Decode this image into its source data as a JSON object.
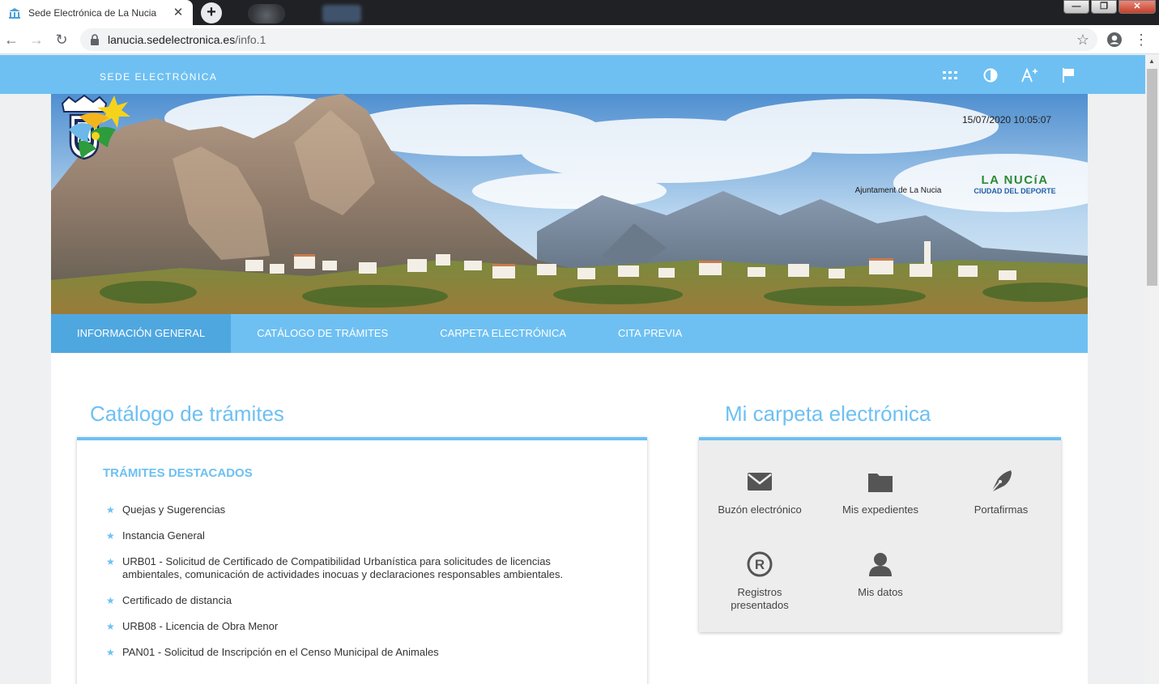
{
  "browser": {
    "tab_title": "Sede Electrónica de La Nucia",
    "url_host": "lanucia.sedelectronica.es",
    "url_path": "/info.1",
    "window_controls": [
      "minimize",
      "restore",
      "close"
    ]
  },
  "topbar": {
    "brand": "SEDE ELECTRÓNICA",
    "tools": [
      "apps-grid-icon",
      "contrast-icon",
      "font-size-icon",
      "flag-icon"
    ],
    "accent_color": "#6ec0f2"
  },
  "banner": {
    "datetime": "15/07/2020 10:05:07",
    "crest_label": "Ajuntament de La Nucia",
    "logo_title": "LA NUCíA",
    "logo_subtitle": "CIUDAD DEL DEPORTE"
  },
  "mainnav": [
    {
      "label": "INFORMACIÓN GENERAL",
      "active": true
    },
    {
      "label": "CATÁLOGO DE TRÁMITES",
      "active": false
    },
    {
      "label": "CARPETA ELECTRÓNICA",
      "active": false
    },
    {
      "label": "CITA PREVIA",
      "active": false
    }
  ],
  "catalogo": {
    "title": "Catálogo de trámites",
    "featured_heading": "TRÁMITES DESTACADOS",
    "items": [
      "Quejas y Sugerencias",
      "Instancia General",
      "URB01 - Solicitud de Certificado de Compatibilidad Urbanística para solicitudes de licencias ambientales, comunicación de actividades inocuas y declaraciones responsables ambientales.",
      "Certificado de distancia",
      "URB08 - Licencia de Obra Menor",
      "PAN01 - Solicitud de Inscripción en el Censo Municipal de Animales"
    ]
  },
  "carpeta": {
    "title": "Mi carpeta electrónica",
    "items": [
      {
        "label": "Buzón electrónico",
        "icon": "envelope-icon"
      },
      {
        "label": "Mis expedientes",
        "icon": "folder-icon"
      },
      {
        "label": "Portafirmas",
        "icon": "pen-nib-icon"
      },
      {
        "label": "Registros presentados",
        "icon": "registered-icon"
      },
      {
        "label": "Mis datos",
        "icon": "user-icon"
      }
    ]
  }
}
